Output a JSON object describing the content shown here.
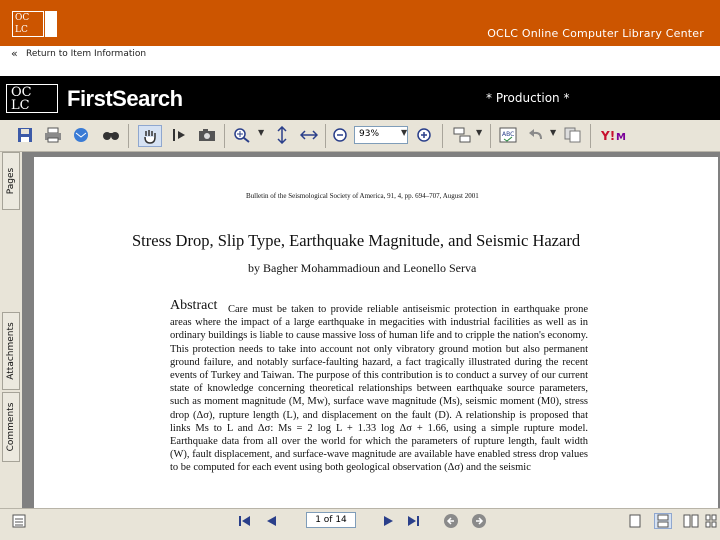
{
  "header": {
    "org_logo_letters": [
      "OC",
      "LC"
    ],
    "org_name": "OCLC Online Computer Library Center"
  },
  "nav": {
    "return_label": "Return to Item Information"
  },
  "firstsearch": {
    "logo_letters": [
      "OC",
      "LC"
    ],
    "title": "FirstSearch",
    "environment": "* Production *"
  },
  "toolbar": {
    "zoom_value": "93%",
    "icons": [
      "save-icon",
      "print-icon",
      "email-icon",
      "search-icon",
      "hand-tool-icon",
      "select-text-icon",
      "snapshot-icon",
      "zoom-in-icon",
      "fit-page-icon",
      "fit-width-icon",
      "zoom-out-icon",
      "zoom-in-plus-icon",
      "page-layout-icon",
      "spell-check-icon",
      "undo-icon",
      "copy-icon",
      "yahoo-toolbar-icon"
    ]
  },
  "side_tabs": {
    "pages": "Pages",
    "attachments": "Attachments",
    "comments": "Comments"
  },
  "document": {
    "bulletin": "Bulletin of the Seismological Society of America, 91, 4, pp. 694–707, August 2001",
    "title": "Stress Drop, Slip Type, Earthquake Magnitude, and Seismic Hazard",
    "authors": "by Bagher Mohammadioun and Leonello Serva",
    "abstract_label": "Abstract",
    "abstract_text": "Care must be taken to provide reliable antiseismic protection in earthquake prone areas where the impact of a large earthquake in megacities with industrial facilities as well as in ordinary buildings is liable to cause massive loss of human life and to cripple the nation's economy. This protection needs to take into account not only vibratory ground motion but also permanent ground failure, and notably surface-faulting hazard, a fact tragically illustrated during the recent events of Turkey and Taiwan. The purpose of this contribution is to conduct a survey of our current state of knowledge concerning theoretical relationships between earthquake source parameters, such as moment magnitude (M, Mw), surface wave magnitude (Ms), seismic moment (M0), stress drop (Δσ), rupture length (L), and displacement on the fault (D). A relationship is proposed that links Ms to L and Δσ: Ms = 2 log L + 1.33 log Δσ + 1.66, using a simple rupture model. Earthquake data from all over the world for which the parameters of rupture length, fault width (W), fault displacement, and surface-wave magnitude are available have enabled stress drop values to be computed for each event using both geological observation (Δσ) and the seismic"
  },
  "statusbar": {
    "page_indicator": "1 of 14"
  }
}
